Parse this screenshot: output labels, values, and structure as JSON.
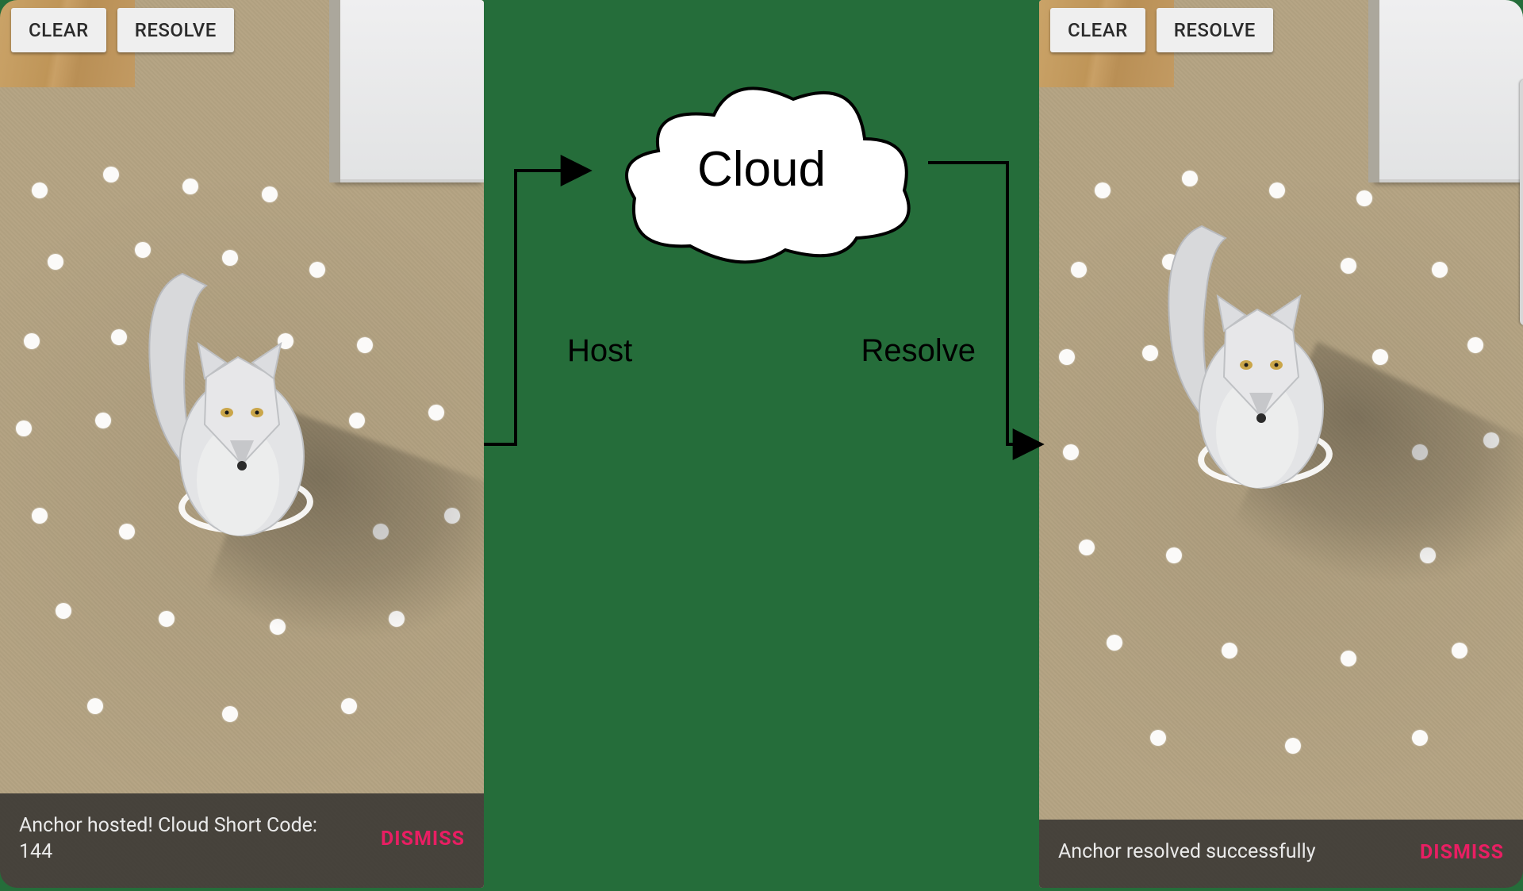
{
  "left_phone": {
    "toolbar": {
      "clear": "CLEAR",
      "resolve": "RESOLVE"
    },
    "snackbar": {
      "message": "Anchor hosted! Cloud Short Code: 144",
      "action": "DISMISS"
    }
  },
  "right_phone": {
    "toolbar": {
      "clear": "CLEAR",
      "resolve": "RESOLVE"
    },
    "snackbar": {
      "message": "Anchor resolved successfully",
      "action": "DISMISS"
    }
  },
  "diagram": {
    "cloud_label": "Cloud",
    "host_label": "Host",
    "resolve_label": "Resolve"
  },
  "colors": {
    "background": "#256d3a",
    "button_bg": "#efefef",
    "snackbar_bg": "rgba(40,40,40,0.78)",
    "accent": "#e91e63"
  }
}
